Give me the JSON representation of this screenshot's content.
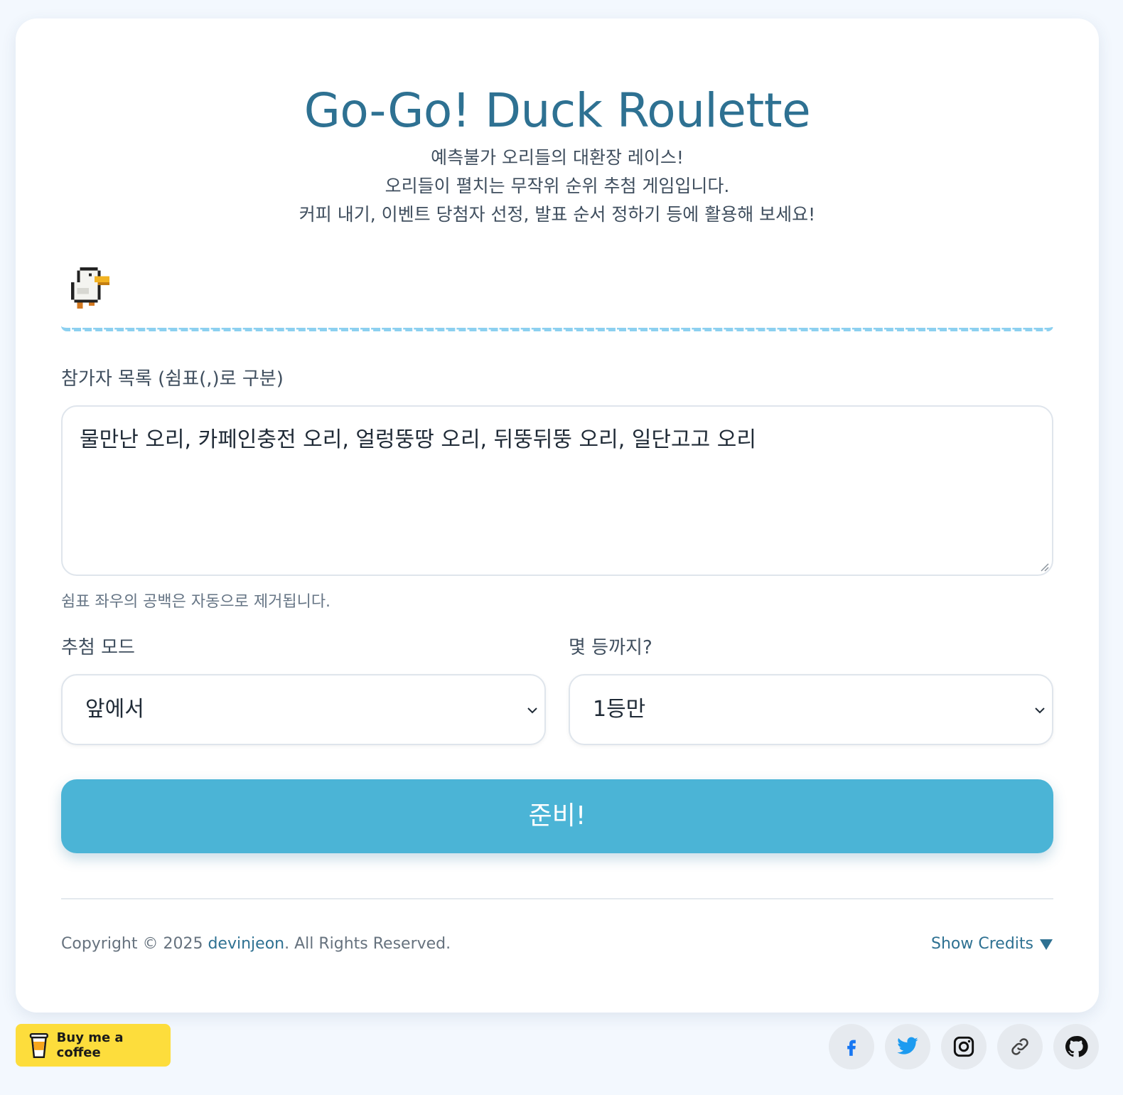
{
  "header": {
    "title": "Go-Go! Duck Roulette",
    "subtitle_lines": [
      "예측불가 오리들의 대환장 레이스!",
      "오리들이 펼치는 무작위 순위 추첨 게임입니다.",
      "커피 내기, 이벤트 당첨자 선정, 발표 순서 정하기 등에 활용해 보세요!"
    ]
  },
  "participants": {
    "label": "참가자 목록 (쉼표(,)로 구분)",
    "value": "물만난 오리, 카페인충전 오리, 얼렁뚱땅 오리, 뒤뚱뒤뚱 오리, 일단고고 오리",
    "hint": "쉼표 좌우의 공백은 자동으로 제거됩니다."
  },
  "mode": {
    "label": "추첨 모드",
    "selected": "앞에서"
  },
  "rank": {
    "label": "몇 등까지?",
    "selected": "1등만"
  },
  "ready_button": "준비!",
  "footer": {
    "copyright_prefix": "Copyright © 2025 ",
    "author": "devinjeon",
    "copyright_suffix": ". All Rights Reserved.",
    "credits_toggle": "Show Credits"
  },
  "bmc": {
    "label": "Buy me a coffee"
  },
  "social": [
    "facebook-icon",
    "twitter-icon",
    "instagram-icon",
    "link-icon",
    "github-icon"
  ],
  "colors": {
    "accent": "#4bb4d6",
    "title": "#2e7192",
    "track": "#8cd0f0",
    "bmc": "#fddd3c"
  }
}
